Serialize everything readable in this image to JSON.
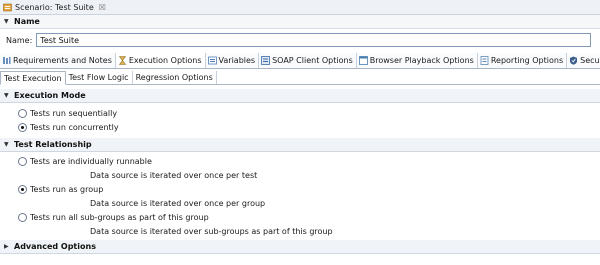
{
  "editor": {
    "title": "Scenario: Test Suite",
    "close": "☒"
  },
  "name_section": {
    "header": "Name",
    "label": "Name:",
    "value": "Test Suite"
  },
  "page_tabs": [
    {
      "label": "Requirements and Notes",
      "icon": "notes-icon",
      "color": "#6a8fbf"
    },
    {
      "label": "Execution Options",
      "icon": "hourglass-icon",
      "color": "#b58a2c",
      "active": true
    },
    {
      "label": "Variables",
      "icon": "variables-icon",
      "color": "#4f7db8"
    },
    {
      "label": "SOAP Client Options",
      "icon": "soap-client-icon",
      "color": "#3b6aa8"
    },
    {
      "label": "Browser Playback Options",
      "icon": "browser-icon",
      "color": "#4a7fb0"
    },
    {
      "label": "Reporting Options",
      "icon": "reporting-icon",
      "color": "#5c86b3"
    },
    {
      "label": "Security Options",
      "icon": "security-icon",
      "color": "#3d5f8c"
    }
  ],
  "sub_tabs": [
    {
      "label": "Test Execution",
      "active": true
    },
    {
      "label": "Test Flow Logic"
    },
    {
      "label": "Regression Options"
    }
  ],
  "execution_mode": {
    "header": "Execution Mode",
    "options": [
      {
        "label": "Tests run sequentially",
        "selected": false
      },
      {
        "label": "Tests run concurrently",
        "selected": true
      }
    ]
  },
  "test_relationship": {
    "header": "Test Relationship",
    "options": [
      {
        "label": "Tests are individually runnable",
        "selected": false,
        "desc": "Data source is iterated over once per test"
      },
      {
        "label": "Tests run as group",
        "selected": true,
        "desc": "Data source is iterated over once per group"
      },
      {
        "label": "Tests run all sub-groups as part of this group",
        "selected": false,
        "desc": "Data source is iterated over sub-groups as part of this group"
      }
    ]
  },
  "advanced_options": {
    "header": "Advanced Options"
  },
  "twisty": {
    "expanded": "▼",
    "collapsed": "▶"
  }
}
